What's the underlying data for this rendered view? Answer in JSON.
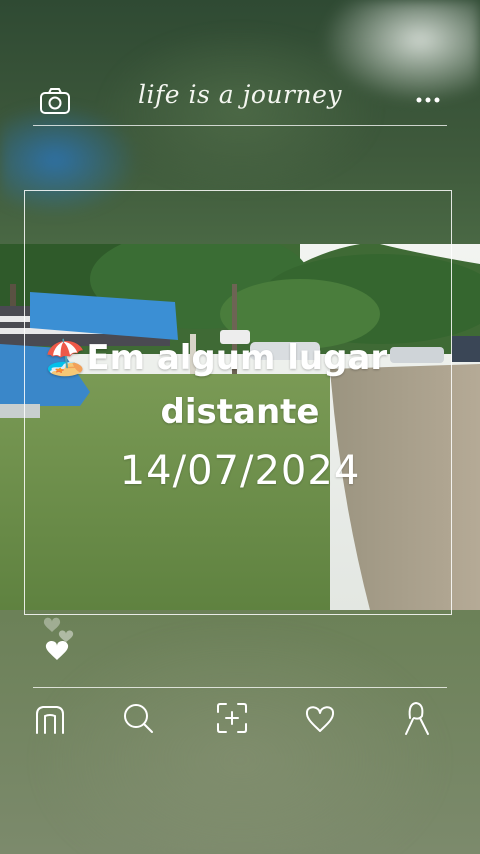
{
  "header": {
    "title": "life is a journey",
    "camera_icon": "camera-icon",
    "more_icon": "more-dots-icon"
  },
  "post": {
    "location_emoji": "🏖️",
    "location_line1": "Em algum lugar",
    "location_line2": "distante",
    "date": "14/07/2024",
    "likes_icon": "hearts-icon"
  },
  "bottom_nav": {
    "items": [
      {
        "icon": "home-icon"
      },
      {
        "icon": "search-icon"
      },
      {
        "icon": "add-icon"
      },
      {
        "icon": "heart-icon"
      },
      {
        "icon": "profile-icon"
      }
    ]
  },
  "colors": {
    "foreground": "#ffffff",
    "sky": "#eef1ee",
    "grass": "#6c8a4a",
    "path": "#a59a86",
    "tarp": "#3a8fd6"
  }
}
